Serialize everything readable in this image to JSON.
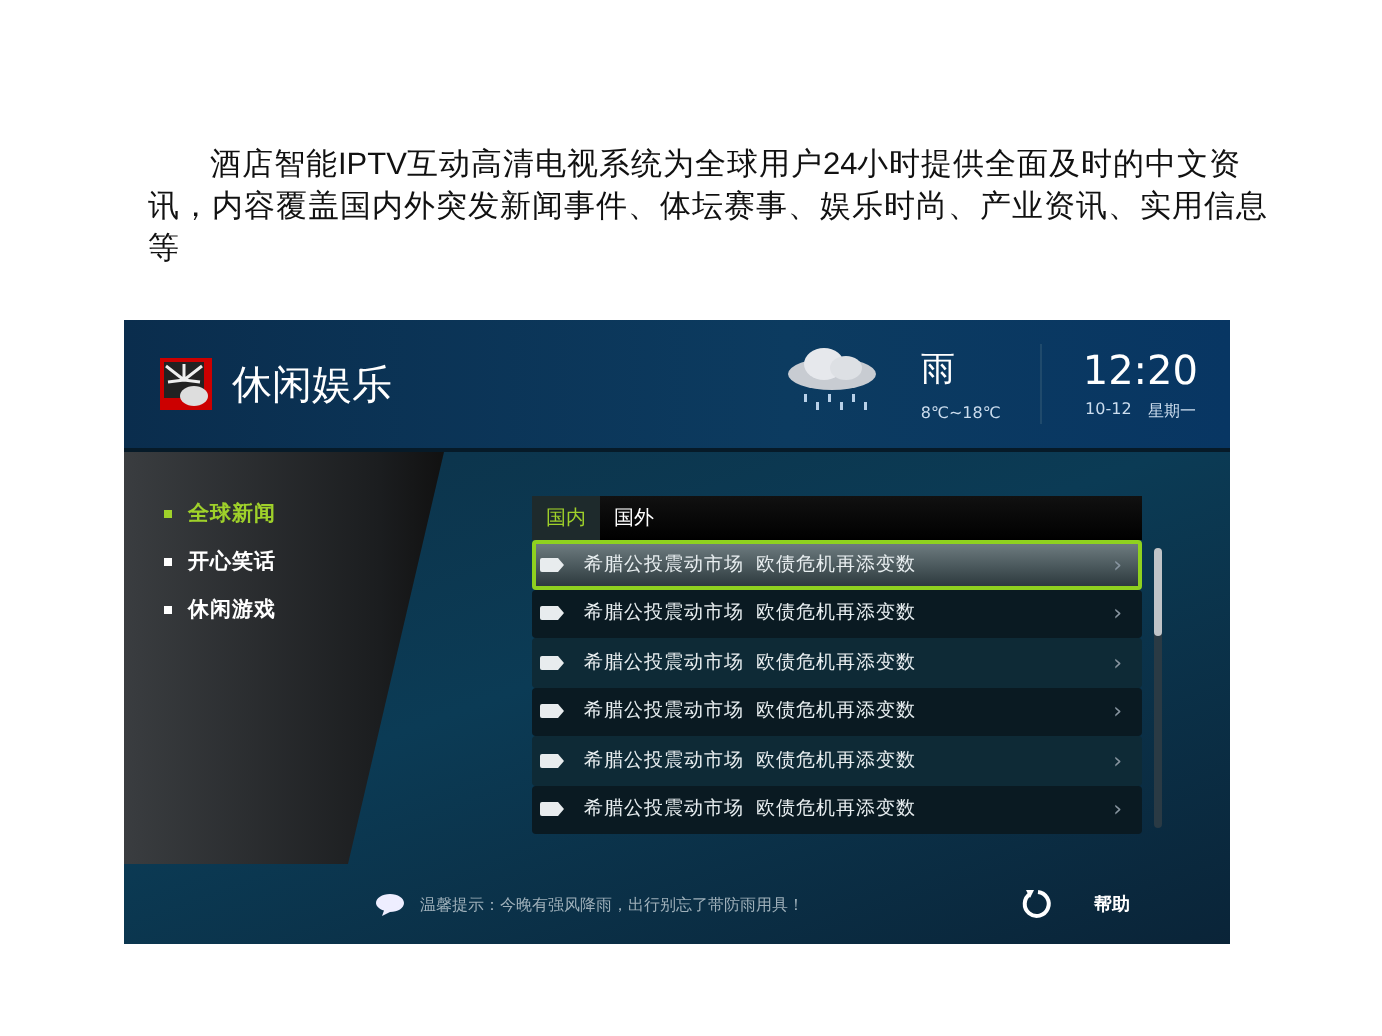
{
  "intro": "酒店智能IPTV互动高清电视系统为全球用户24小时提供全面及时的中文资讯，内容覆盖国内外突发新闻事件、体坛赛事、娱乐时尚、产业资讯、实用信息等",
  "screen": {
    "title": "休闲娱乐",
    "weather": {
      "condition": "雨",
      "range": "8℃~18℃"
    },
    "clock": {
      "time": "12:20",
      "date": "10-12",
      "weekday": "星期一"
    },
    "sidebar": {
      "items": [
        {
          "label": "全球新闻",
          "selected": true
        },
        {
          "label": "开心笑话",
          "selected": false
        },
        {
          "label": "休闲游戏",
          "selected": false
        }
      ]
    },
    "tabs": [
      {
        "label": "国内",
        "selected": true
      },
      {
        "label": "国外",
        "selected": false
      }
    ],
    "rows": [
      {
        "title": "希腊公投震动市场  欧债危机再添变数",
        "selected": true
      },
      {
        "title": "希腊公投震动市场  欧债危机再添变数",
        "selected": false
      },
      {
        "title": "希腊公投震动市场  欧债危机再添变数",
        "selected": false
      },
      {
        "title": "希腊公投震动市场  欧债危机再添变数",
        "selected": false
      },
      {
        "title": "希腊公投震动市场  欧债危机再添变数",
        "selected": false
      },
      {
        "title": "希腊公投震动市场  欧债危机再添变数",
        "selected": false
      }
    ],
    "chevron": "›",
    "tip": "温馨提示：今晚有强风降雨，出行别忘了带防雨用具！",
    "help": "帮助"
  }
}
